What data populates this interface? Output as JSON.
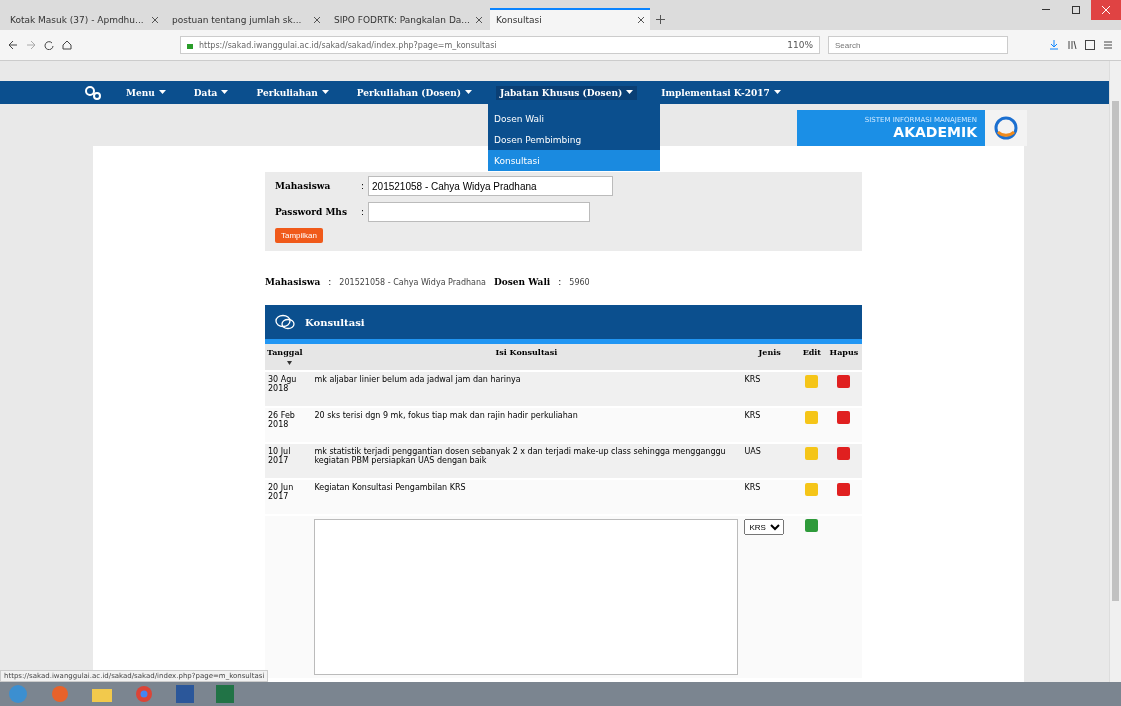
{
  "browser": {
    "tabs": [
      {
        "label": "Kotak Masuk (37) - Apmdhu...",
        "selected": false
      },
      {
        "label": "postuan tentang jumlah sk...",
        "selected": false
      },
      {
        "label": "SIPO FODRTK: Pangkalan Da...",
        "selected": false
      },
      {
        "label": "Konsultasi",
        "selected": true
      }
    ],
    "url": "https://sakad.iwanggulai.ac.id/sakad/sakad/index.php?page=m_konsultasi",
    "zoom": "110%",
    "search": {
      "placeholder": "Search"
    },
    "status_url": "https://sakad.iwanggulai.ac.id/sakad/sakad/index.php?page=m_konsultasi"
  },
  "nav": {
    "items": [
      {
        "label": "Menu",
        "expanded": false
      },
      {
        "label": "Data",
        "expanded": false
      },
      {
        "label": "Perkuliahan",
        "expanded": false
      },
      {
        "label": "Perkuliahan (Dosen)",
        "expanded": false
      },
      {
        "label": "Jabatan Khusus (Dosen)",
        "expanded": true
      },
      {
        "label": "Implementasi K-2017",
        "expanded": false
      }
    ],
    "dropdown": [
      {
        "label": "Dosen Wali",
        "selected": false
      },
      {
        "label": "Dosen Pembimbing",
        "selected": false
      },
      {
        "label": "Konsultasi",
        "selected": true
      }
    ]
  },
  "logo": {
    "subtitle": "SISTEM INFORMASI MANAJEMEN",
    "title": "AKADEMIK"
  },
  "form": {
    "fields": [
      {
        "label": "Mahasiswa",
        "separator": ":",
        "value": "201521058 - Cahya Widya Pradhana"
      },
      {
        "label": "Password Mhs",
        "separator": ":"
      }
    ],
    "button": "Tampilkan"
  },
  "info": [
    {
      "label": "Mahasiswa",
      "separator": ":",
      "value": "201521058 - Cahya Widya Pradhana"
    },
    {
      "label": "Dosen Wali",
      "separator": ":",
      "value": "5960"
    }
  ],
  "card": {
    "title": "Konsultasi",
    "columns": [
      "Tanggal",
      "Isi Konsultasi",
      "Jenis",
      "Edit",
      "Hapus"
    ],
    "rows": [
      {
        "date": "30 Agu 2018",
        "text": "mk aljabar linier belum ada jadwal jam dan harinya",
        "type": "KRS"
      },
      {
        "date": "26 Feb 2018",
        "text": "20 sks terisi dgn 9 mk, fokus tiap mak dan rajin hadir perkuliahan",
        "type": "KRS"
      },
      {
        "date": "10 Jul 2017",
        "text": "mk statistik terjadi penggantian dosen sebanyak 2 x dan terjadi make-up class sehingga mengganggu kegiatan PBM persiapkan UAS dengan baik",
        "type": "UAS"
      },
      {
        "date": "20 Jun 2017",
        "text": "Kegiatan Konsultasi Pengambilan KRS",
        "type": "KRS"
      }
    ],
    "new_row": {
      "type": "KRS"
    }
  }
}
